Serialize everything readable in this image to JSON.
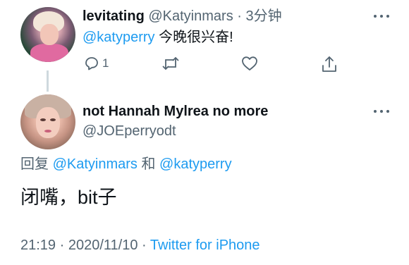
{
  "tweet1": {
    "name": "levitating",
    "handle": "@Katyinmars",
    "separator": "·",
    "time": "3分钟",
    "mention": "@katyperry",
    "text": "今晚很兴奋!",
    "reply_count": "1",
    "icons": [
      "reply-icon",
      "retweet-icon",
      "like-icon",
      "share-icon",
      "more-icon"
    ]
  },
  "tweet2": {
    "name": "not Hannah Mylrea no more",
    "handle": "@JOEperryodt",
    "reply_prefix": "回复",
    "reply_mention1": "@Katyinmars",
    "reply_and": "和",
    "reply_mention2": "@katyperry",
    "text": "闭嘴，bit子",
    "time": "21:19",
    "separator": "·",
    "date": "2020/11/10",
    "source": "Twitter for iPhone"
  },
  "colors": {
    "accent": "#1d9bf0",
    "secondary_text": "#536471",
    "primary_text": "#0f1419"
  }
}
